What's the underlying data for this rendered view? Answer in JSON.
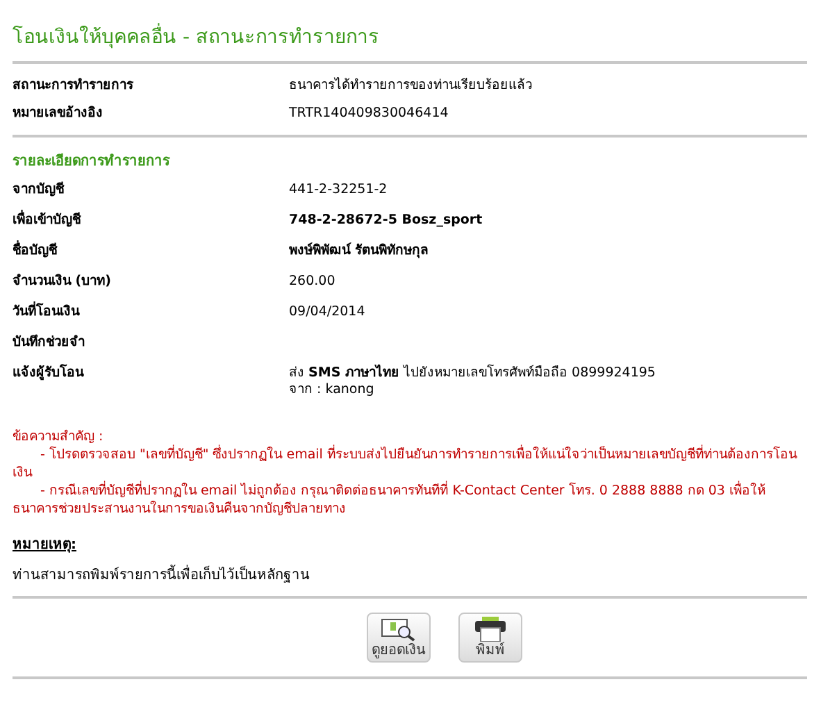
{
  "title": "โอนเงินให้บุคคลอื่น - สถานะการทำรายการ",
  "summary": [
    {
      "label": "สถานะการทำรายการ",
      "lines": [
        "ธนาคารได้ทำรายการของท่านเรียบร้อยแล้ว"
      ],
      "bold": false
    },
    {
      "label": "หมายเลขอ้างอิง",
      "lines": [
        "TRTR140409830046414"
      ],
      "bold": false
    }
  ],
  "details_heading": "รายละเอียดการทำรายการ",
  "details": [
    {
      "label": "จากบัญชี",
      "lines": [
        "441-2-32251-2"
      ],
      "bold": false
    },
    {
      "label": "เพื่อเข้าบัญชี",
      "lines": [
        "748-2-28672-5 Bosz_sport"
      ],
      "bold": true
    },
    {
      "label": "ชื่อบัญชี",
      "lines": [
        "พงษ์พิพัฒน์ รัตนพิทักษกุล"
      ],
      "bold": true
    },
    {
      "label": "จำนวนเงิน (บาท)",
      "lines": [
        "260.00"
      ],
      "bold": false
    },
    {
      "label": "วันที่โอนเงิน",
      "lines": [
        "09/04/2014"
      ],
      "bold": false
    },
    {
      "label": "บันทึกช่วยจำ"
    },
    {
      "label": "แจ้งผู้รับโอน",
      "lines": [
        "ส่ง **SMS ภาษาไทย** ไปยังหมายเลขโทรศัพท์มือถือ 0899924195",
        "จาก : kanong"
      ],
      "bold": false
    }
  ],
  "important": {
    "heading": "ข้อความสำคัญ :",
    "items": [
      "- โปรดตรวจสอบ \"เลขที่บัญชี\" ซึ่งปรากฏใน email ที่ระบบส่งไปยืนยันการทำรายการเพื่อให้แน่ใจว่าเป็นหมายเลขบัญชีที่ท่านต้องการโอนเงิน",
      "- กรณีเลขที่บัญชีที่ปรากฏใน email ไม่ถูกต้อง กรุณาติดต่อธนาคารทันทีที่ K-Contact Center โทร. 0 2888 8888 กด 03 เพื่อให้ธนาคารช่วยประสานงานในการขอเงินคืนจากบัญชีปลายทาง"
    ]
  },
  "remark": {
    "heading": "หมายเหตุ:",
    "text": "ท่านสามารถพิมพ์รายการนี้เพื่อเก็บไว้เป็นหลักฐาน"
  },
  "buttons": [
    {
      "kind": "balance",
      "label": "ดูยอดเงิน"
    },
    {
      "kind": "print",
      "label": "พิมพ์"
    }
  ]
}
